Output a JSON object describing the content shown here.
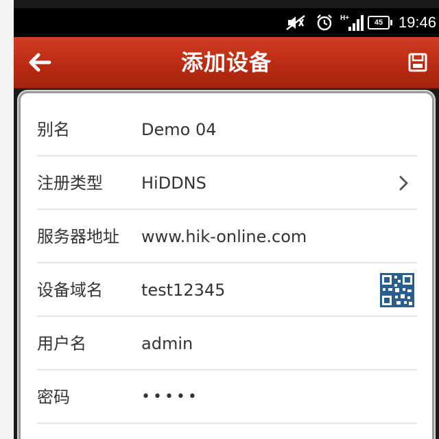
{
  "status_bar": {
    "time": "19:46",
    "battery": "45",
    "network_type": "H+",
    "icons": [
      "mute-icon",
      "alarm-icon",
      "signal-icon",
      "battery-icon"
    ]
  },
  "title_bar": {
    "title": "添加设备",
    "back_icon": "back-arrow-icon",
    "save_icon": "save-icon",
    "color": "#c4331a"
  },
  "form": {
    "rows": [
      {
        "label": "别名",
        "value": "Demo 04"
      },
      {
        "label": "注册类型",
        "value": "HiDDNS",
        "accessory": "chevron-right-icon"
      },
      {
        "label": "服务器地址",
        "value": "www.hik-online.com"
      },
      {
        "label": "设备域名",
        "value": "test12345",
        "accessory": "qr-code-icon"
      },
      {
        "label": "用户名",
        "value": "admin"
      },
      {
        "label": "密码",
        "value": "•••••"
      }
    ]
  }
}
